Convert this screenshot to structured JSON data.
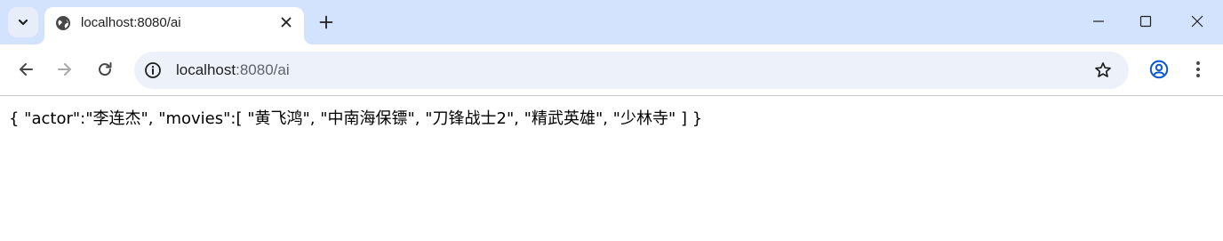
{
  "tabstrip": {
    "tab": {
      "title": "localhost:8080/ai",
      "favicon": "globe-icon"
    },
    "new_tab_icon": "plus-icon",
    "search_tabs_icon": "chevron-down-icon",
    "window_controls": [
      "minimize-icon",
      "maximize-icon",
      "close-icon"
    ]
  },
  "toolbar": {
    "back_icon": "arrow-left-icon",
    "forward_icon": "arrow-right-icon",
    "reload_icon": "reload-icon",
    "site_info_icon": "info-icon",
    "url_host": "localhost",
    "url_rest": ":8080/ai",
    "bookmark_icon": "star-icon",
    "profile_icon": "profile-icon",
    "menu_icon": "kebab-menu-icon"
  },
  "page": {
    "body_text": "{ \"actor\":\"李连杰\", \"movies\":[ \"黄飞鸿\", \"中南海保镖\", \"刀锋战士2\", \"精武英雄\", \"少林寺\" ] }"
  },
  "colors": {
    "tabstrip_bg": "#d3e3fd",
    "omnibox_bg": "#edf2fa",
    "icon": "#474747",
    "profile_accent": "#0b57d0"
  }
}
